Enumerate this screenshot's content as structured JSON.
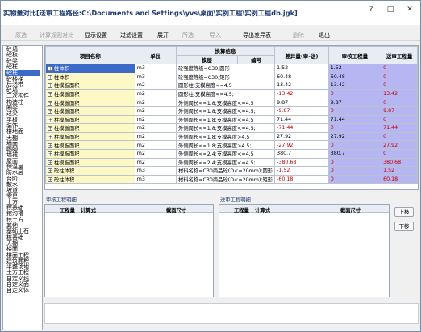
{
  "title": "实物量对比[送审工程路径:C:\\Documents and Settings\\yvs\\桌面\\实例工程\\实例工程db.jgk]",
  "window_buttons": [
    "?",
    "□",
    "✕"
  ],
  "menu": [
    {
      "label": "原选",
      "disabled": true
    },
    {
      "label": "计算规则对比",
      "disabled": true
    },
    {
      "label": "显示设置",
      "disabled": false
    },
    {
      "label": "过滤设置",
      "disabled": false
    },
    {
      "label": "展开",
      "disabled": false
    },
    {
      "label": "所选",
      "disabled": true
    },
    {
      "label": "导入",
      "disabled": true
    },
    {
      "label": "导出差异表",
      "disabled": false
    },
    {
      "label": "删除",
      "disabled": true
    },
    {
      "label": "退出",
      "disabled": false
    }
  ],
  "sidebar": [
    "砼墙",
    "砼板",
    "砼梁",
    "砼柱",
    "砼柱",
    "砼楼梯",
    "后浇带",
    "砼墙",
    "二次构件",
    "构造柱",
    "圈梁",
    "过梁",
    "平板",
    "装饰",
    "楼地面",
    "天棚",
    "墙面",
    "踢脚",
    "墙裙",
    "屋面",
    "保温层",
    "防水层",
    "台阶",
    "散水",
    "坡道",
    "零星",
    "土方",
    "挖基础",
    "挖沟槽",
    "挖土方",
    "其他",
    "基础土石",
    "桩基础",
    "天棚",
    "楼面",
    "楼面工程",
    "建筑面积",
    "平整场地",
    "土方工程",
    "自定义线",
    "自定义面",
    "自定义体"
  ],
  "sidebar_selected": 4,
  "table": {
    "headers": {
      "name": "项目名称",
      "unit": "单位",
      "info": "换算信息",
      "info_sub_a": "模层",
      "info_sub_b": "编号",
      "diff": "差异量(审-送)",
      "audit": "审核工程量",
      "send": "送审工程量"
    },
    "rows": [
      {
        "name": "柱体积",
        "unit": "m3",
        "info": "砼强度等级=C30;圆形",
        "diff": "1.52",
        "audit": "1.52",
        "send": "0",
        "neg": false,
        "selected": true
      },
      {
        "name": "柱体积",
        "unit": "m3",
        "info": "砼强度等级=C30;矩形",
        "diff": "60.48",
        "audit": "60.48",
        "send": "0",
        "neg": false,
        "selected": false
      },
      {
        "name": "柱模板面积",
        "unit": "m2",
        "info": "圆形柱;支模高度<=4.5",
        "diff": "13.42",
        "audit": "13.42",
        "send": "0",
        "neg": false,
        "selected": false
      },
      {
        "name": "柱模板面积",
        "unit": "m2",
        "info": "圆形柱;支模高度<=4.5;",
        "diff": "-13.42",
        "audit": "0",
        "send": "13.42",
        "neg": true,
        "selected": false
      },
      {
        "name": "柱模板面积",
        "unit": "m2",
        "info": "外侧周长<=1.8;支模高度<=4.5",
        "diff": "9.87",
        "audit": "9.87",
        "send": "0",
        "neg": false,
        "selected": false
      },
      {
        "name": "柱模板面积",
        "unit": "m2",
        "info": "外侧周长<=1.8;支模高度<=4.5;",
        "diff": "-9.87",
        "audit": "0",
        "send": "9.87",
        "neg": true,
        "selected": false
      },
      {
        "name": "柱模板面积",
        "unit": "m2",
        "info": "外侧周长<=1.8;支模高度<=4.5",
        "diff": "71.44",
        "audit": "71.44",
        "send": "0",
        "neg": false,
        "selected": false
      },
      {
        "name": "柱模板面积",
        "unit": "m2",
        "info": "外侧周长<=1.8;支模高度<=4.5;",
        "diff": "-71.44",
        "audit": "0",
        "send": "71.44",
        "neg": true,
        "selected": false
      },
      {
        "name": "柱模板面积",
        "unit": "m2",
        "info": "外侧周长<=1.8;支模高度>4.5",
        "diff": "27.92",
        "audit": "27.92",
        "send": "0",
        "neg": false,
        "selected": false
      },
      {
        "name": "柱模板面积",
        "unit": "m2",
        "info": "外侧周长<=1.8;支模高度>4.5;",
        "diff": "-27.92",
        "audit": "0",
        "send": "27.92",
        "neg": true,
        "selected": false
      },
      {
        "name": "柱模板面积",
        "unit": "m2",
        "info": "外侧周长<=2.4;支模高度<=4.5",
        "diff": "380.7",
        "audit": "380.7",
        "send": "0",
        "neg": false,
        "selected": false
      },
      {
        "name": "柱模板面积",
        "unit": "m2",
        "info": "外侧周长<=2.4;支模高度<=4.5;",
        "diff": "-380.68",
        "audit": "0",
        "send": "380.68",
        "neg": true,
        "selected": false
      },
      {
        "name": "砼柱体积",
        "unit": "m3",
        "info": "材料名称=C30商品砼(D<=20mm);圆形",
        "diff": "-1.52",
        "audit": "0",
        "send": "1.52",
        "neg": true,
        "selected": false
      },
      {
        "name": "砼柱体积",
        "unit": "m3",
        "info": "材料名称=C30商品砼(D<=20mm);矩形",
        "diff": "-60.18",
        "audit": "0",
        "send": "60.18",
        "neg": true,
        "selected": false
      }
    ]
  },
  "audit_panel": {
    "title": "审核工程明细",
    "cols": [
      "工程量",
      "计算式",
      "截面尺寸"
    ]
  },
  "send_panel": {
    "title": "送审工程明细",
    "cols": [
      "工程量",
      "计算式",
      "截面尺寸"
    ]
  },
  "buttons": {
    "up": "上移",
    "down": "下移"
  }
}
